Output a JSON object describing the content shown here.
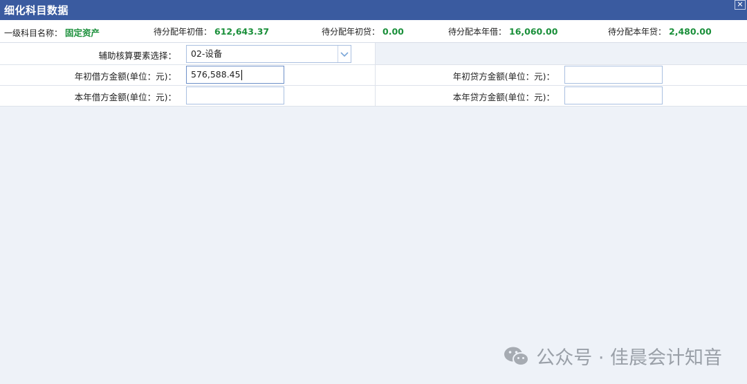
{
  "window": {
    "title": "细化科目数据",
    "close_glyph": "✕"
  },
  "summary": [
    {
      "label": "一级科目名称：",
      "value": "固定资产"
    },
    {
      "label": "待分配年初借：",
      "value": "612,643.37"
    },
    {
      "label": "待分配年初贷：",
      "value": "0.00"
    },
    {
      "label": "待分配本年借：",
      "value": "16,060.00"
    },
    {
      "label": "待分配本年贷：",
      "value": "2,480.00"
    }
  ],
  "form": {
    "aux_label": "辅助核算要素选择：",
    "aux_value": "02-设备",
    "opening_debit_label": "年初借方金额(单位：元)：",
    "opening_debit_value": "576,588.45",
    "opening_credit_label": "年初贷方金额(单位：元)：",
    "opening_credit_value": "",
    "current_debit_label": "本年借方金额(单位：元)：",
    "current_debit_value": "",
    "current_credit_label": "本年贷方金额(单位：元)：",
    "current_credit_value": ""
  },
  "watermark": {
    "text": "公众号 · 佳晨会计知音",
    "icon": "wechat-icon"
  },
  "colors": {
    "titlebar": "#3a5ba0",
    "value_green": "#1a8f3a",
    "background": "#eef2f8"
  }
}
